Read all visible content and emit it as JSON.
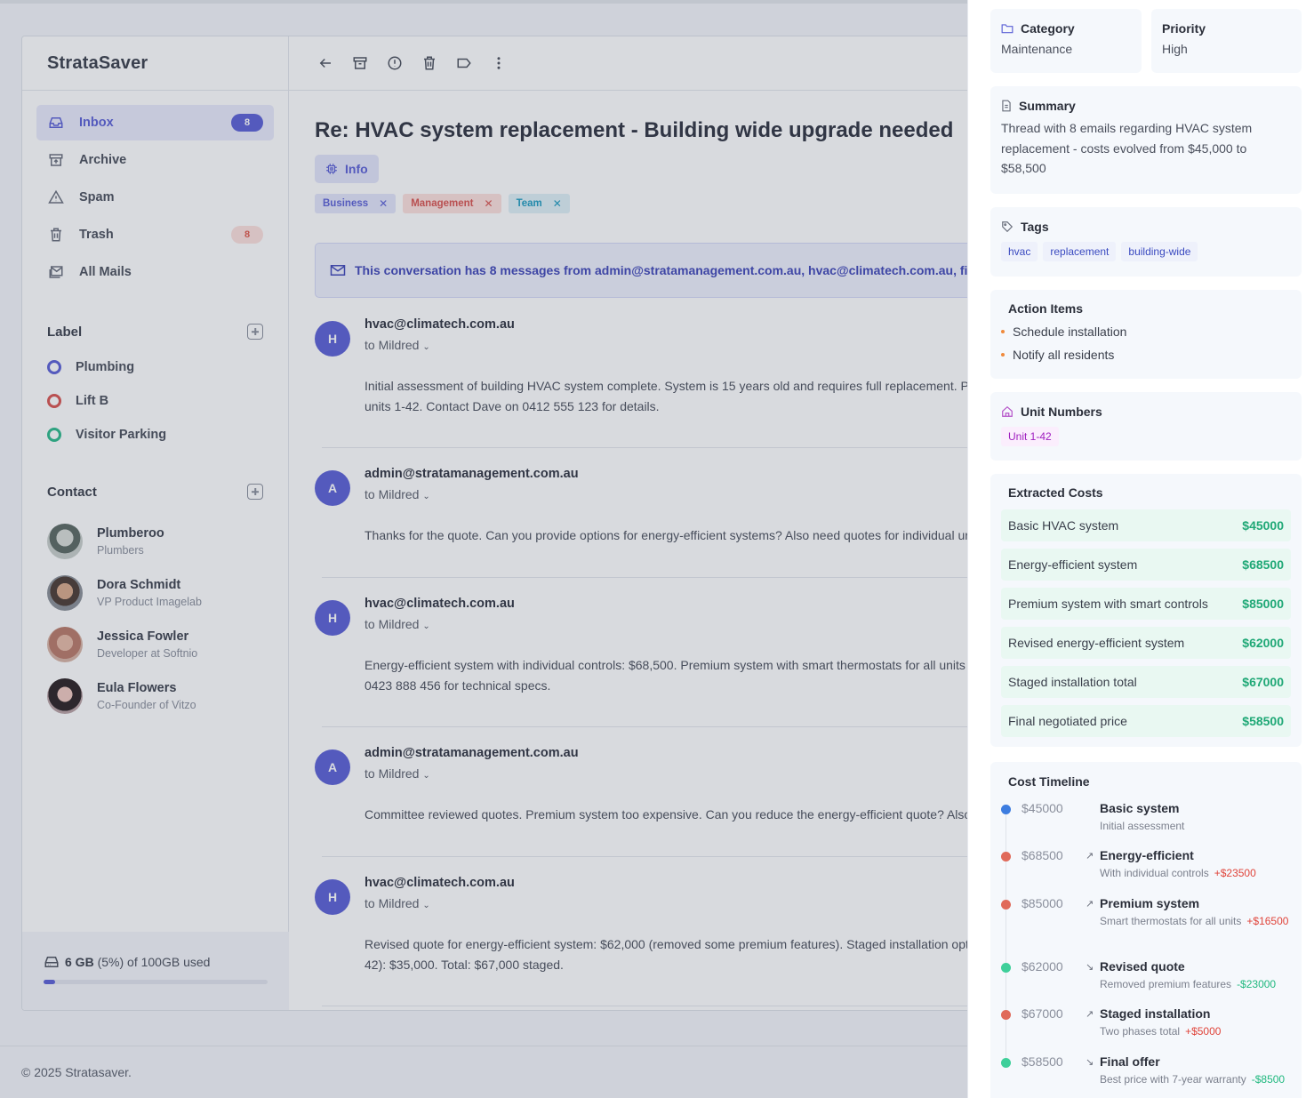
{
  "app": {
    "brand": "StrataSaver"
  },
  "sidebar": {
    "nav": [
      {
        "label": "Inbox",
        "badge": "8",
        "icon": "inbox-icon"
      },
      {
        "label": "Archive",
        "icon": "archive-icon"
      },
      {
        "label": "Spam",
        "icon": "warning-icon"
      },
      {
        "label": "Trash",
        "badge": "8",
        "icon": "trash-icon"
      },
      {
        "label": "All Mails",
        "icon": "mails-icon"
      }
    ],
    "label_heading": "Label",
    "labels": [
      {
        "name": "Plumbing",
        "color": "#5b60d6"
      },
      {
        "name": "Lift B",
        "color": "#d9534f"
      },
      {
        "name": "Visitor Parking",
        "color": "#2bb98a"
      }
    ],
    "contact_heading": "Contact",
    "contacts": [
      {
        "name": "Plumberoo",
        "role": "Plumbers"
      },
      {
        "name": "Dora Schmidt",
        "role": "VP Product Imagelab"
      },
      {
        "name": "Jessica Fowler",
        "role": "Developer at Softnio"
      },
      {
        "name": "Eula Flowers",
        "role": "Co-Founder of Vitzo"
      }
    ],
    "storage": {
      "used": "6 GB",
      "text": "(5%) of 100GB used",
      "percent": 5
    }
  },
  "email": {
    "subject": "Re: HVAC system replacement - Building wide upgrade needed",
    "info_label": "Info",
    "tags": [
      {
        "label": "Business",
        "bg": "#e3e5fb",
        "fg": "#5b60d6"
      },
      {
        "label": "Management",
        "bg": "#fde0dd",
        "fg": "#d9534f"
      },
      {
        "label": "Team",
        "bg": "#dff1f7",
        "fg": "#1e9bc0"
      }
    ],
    "notice": "This conversation has 8 messages from admin@stratamanagement.com.au, hvac@climatech.com.au, finance@",
    "messages": [
      {
        "initial": "H",
        "from": "hvac@climatech.com.au",
        "to": "to Mildred",
        "body1": "Initial assessment of building HVAC system complete. System is 15 years old and requires full replacement. P",
        "body2": "units 1-42. Contact Dave on 0412 555 123 for details."
      },
      {
        "initial": "A",
        "from": "admin@stratamanagement.com.au",
        "to": "to Mildred",
        "body1": "Thanks for the quote. Can you provide options for energy-efficient systems? Also need quotes for individual ur",
        "body2": ""
      },
      {
        "initial": "H",
        "from": "hvac@climatech.com.au",
        "to": "to Mildred",
        "body1": "Energy-efficient system with individual controls: $68,500. Premium system with smart thermostats for all units",
        "body2": "0423 888 456 for technical specs."
      },
      {
        "initial": "A",
        "from": "admin@stratamanagement.com.au",
        "to": "to Mildred",
        "body1": "Committee reviewed quotes. Premium system too expensive. Can you reduce the energy-efficient quote? Also,",
        "body2": ""
      },
      {
        "initial": "H",
        "from": "hvac@climatech.com.au",
        "to": "to Mildred",
        "body1": "Revised quote for energy-efficient system: $62,000 (removed some premium features). Staged installation opt",
        "body2": "42): $35,000. Total: $67,000 staged."
      }
    ]
  },
  "footer": {
    "text": "© 2025 Stratasaver."
  },
  "panel": {
    "category": {
      "title": "Category",
      "value": "Maintenance"
    },
    "priority": {
      "title": "Priority",
      "value": "High"
    },
    "summary": {
      "title": "Summary",
      "text": "Thread with 8 emails regarding HVAC system replacement - costs evolved from $45,000 to $58,500"
    },
    "tags": {
      "title": "Tags",
      "items": [
        "hvac",
        "replacement",
        "building-wide"
      ]
    },
    "actions": {
      "title": "Action Items",
      "items": [
        "Schedule installation",
        "Notify all residents"
      ]
    },
    "units": {
      "title": "Unit Numbers",
      "items": [
        "Unit 1-42"
      ]
    },
    "costs": {
      "title": "Extracted Costs",
      "items": [
        {
          "label": "Basic HVAC system",
          "amount": "$45000"
        },
        {
          "label": "Energy-efficient system",
          "amount": "$68500"
        },
        {
          "label": "Premium system with smart controls",
          "amount": "$85000"
        },
        {
          "label": "Revised energy-efficient system",
          "amount": "$62000"
        },
        {
          "label": "Staged installation total",
          "amount": "$67000"
        },
        {
          "label": "Final negotiated price",
          "amount": "$58500"
        }
      ]
    },
    "timeline": {
      "title": "Cost Timeline",
      "items": [
        {
          "price": "$45000",
          "arrow": "",
          "title": "Basic system",
          "desc": "Initial assessment",
          "delta": "",
          "dot": "#3d7de0",
          "delta_color": ""
        },
        {
          "price": "$68500",
          "arrow": "↗",
          "title": "Energy-efficient",
          "desc": "With individual controls",
          "delta": "+$23500",
          "dot": "#e06a5a",
          "delta_color": "#e0443a"
        },
        {
          "price": "$85000",
          "arrow": "↗",
          "title": "Premium system",
          "desc": "Smart thermostats for all units",
          "delta": "+$16500",
          "dot": "#e06a5a",
          "delta_color": "#e0443a"
        },
        {
          "price": "$62000",
          "arrow": "↘",
          "title": "Revised quote",
          "desc": "Removed premium features",
          "delta": "-$23000",
          "dot": "#3ecf9a",
          "delta_color": "#1fb87e"
        },
        {
          "price": "$67000",
          "arrow": "↗",
          "title": "Staged installation",
          "desc": "Two phases total",
          "delta": "+$5000",
          "dot": "#e06a5a",
          "delta_color": "#e0443a"
        },
        {
          "price": "$58500",
          "arrow": "↘",
          "title": "Final offer",
          "desc": "Best price with 7-year warranty",
          "delta": "-$8500",
          "dot": "#3ecf9a",
          "delta_color": "#1fb87e"
        }
      ]
    }
  }
}
